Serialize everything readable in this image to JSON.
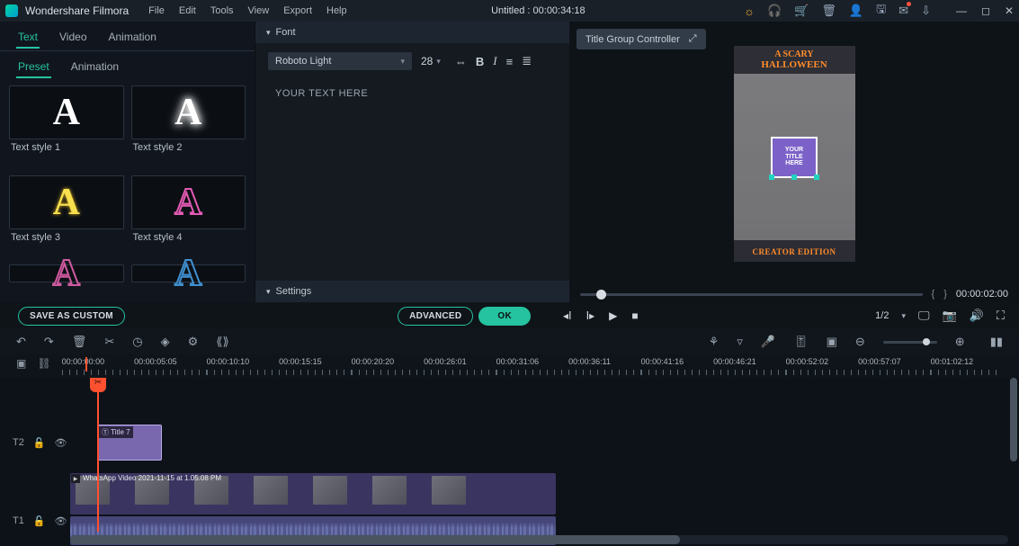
{
  "app": {
    "name": "Wondershare Filmora"
  },
  "menu": {
    "file": "File",
    "edit": "Edit",
    "tools": "Tools",
    "view": "View",
    "export": "Export",
    "help": "Help"
  },
  "title": "Untitled : 00:00:34:18",
  "tabs": {
    "text": "Text",
    "video": "Video",
    "animation": "Animation"
  },
  "subtabs": {
    "preset": "Preset",
    "animation": "Animation"
  },
  "styles": {
    "s1": "Text style 1",
    "s2": "Text style 2",
    "s3": "Text style 3",
    "s4": "Text style 4"
  },
  "font": {
    "section": "Font",
    "family": "Roboto Light",
    "size": "28",
    "placeholder": "YOUR TEXT HERE",
    "settings": "Settings"
  },
  "buttons": {
    "save_custom": "SAVE AS CUSTOM",
    "advanced": "ADVANCED",
    "ok": "OK"
  },
  "preview": {
    "title_group": "Title Group Controller",
    "scary": "A SCARY",
    "halloween": "HALLOWEEN",
    "your": "YOUR",
    "titletxt": "TITLE",
    "here": "HERE",
    "creator": "CREATOR EDITION",
    "brackets_l": "{",
    "brackets_r": "}",
    "time": "00:00:02:00",
    "page": "1/2"
  },
  "ruler": {
    "marks": [
      "00:00:00:00",
      "00:00:05:05",
      "00:00:10:10",
      "00:00:15:15",
      "00:00:20:20",
      "00:00:26:01",
      "00:00:31:06",
      "00:00:36:11",
      "00:00:41:16",
      "00:00:46:21",
      "00:00:52:02",
      "00:00:57:07",
      "00:01:02:12"
    ]
  },
  "tracks": {
    "t2": "T2",
    "t1": "T1",
    "title_clip": "Title 7",
    "video_clip": "WhatsApp Video 2021-11-15 at 1.05.08 PM"
  }
}
